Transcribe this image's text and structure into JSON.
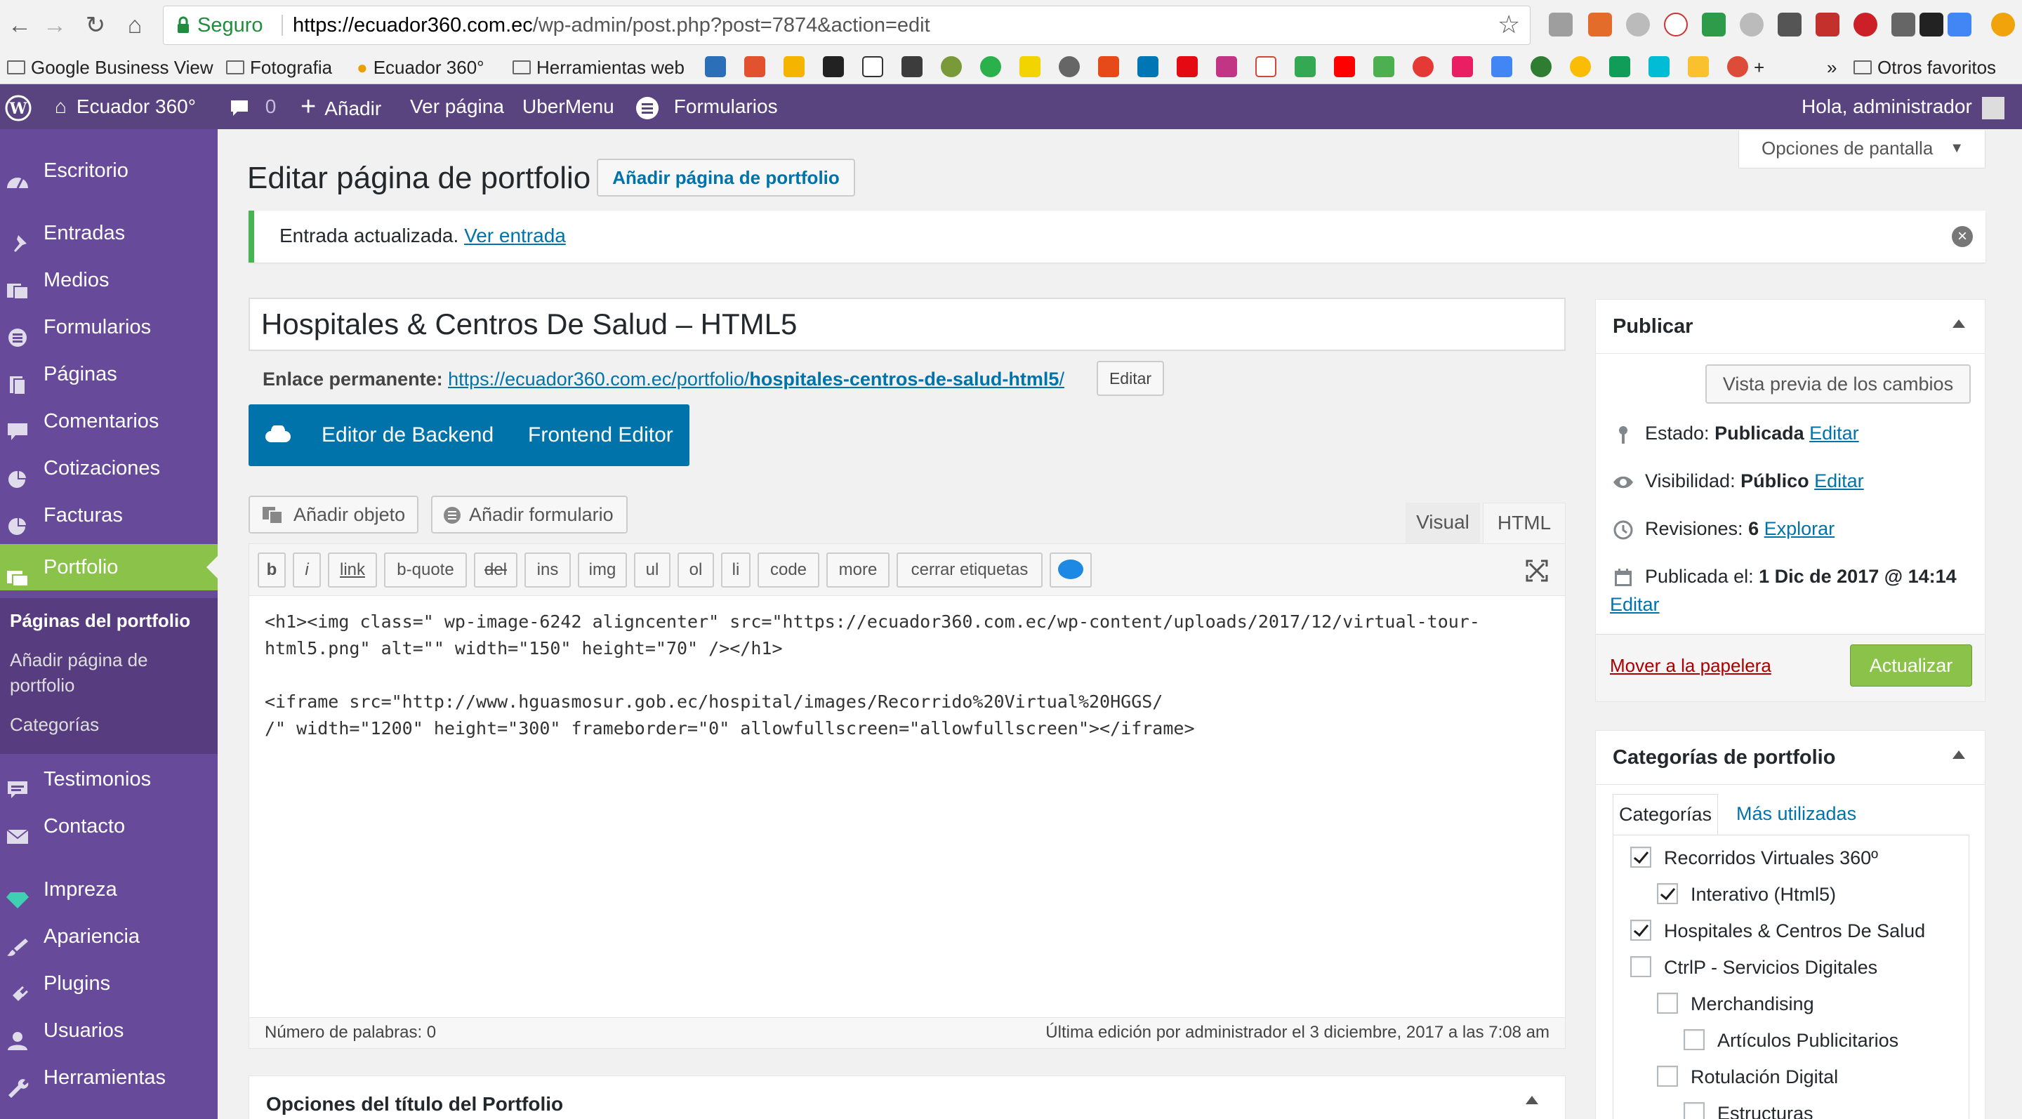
{
  "browser": {
    "security_label": "Seguro",
    "url_host": "https://ecuador360.com.ec",
    "url_path": "/wp-admin/post.php?post=7874&action=edit",
    "bookmarks": [
      "Google Business View",
      "Fotografia",
      "Ecuador 360°",
      "Herramientas web"
    ],
    "more_label": "»",
    "other_bookmarks": "Otros favoritos"
  },
  "adminbar": {
    "site_name": "Ecuador 360°",
    "comments_count": "0",
    "add_label": "Añadir",
    "view_page": "Ver página",
    "ubermenu": "UberMenu",
    "forms": "Formularios",
    "greeting": "Hola, administrador"
  },
  "sidebar": {
    "items": [
      "Escritorio",
      "Entradas",
      "Medios",
      "Formularios",
      "Páginas",
      "Comentarios",
      "Cotizaciones",
      "Facturas",
      "Portfolio",
      "Testimonios",
      "Contacto",
      "Impreza",
      "Apariencia",
      "Plugins",
      "Usuarios",
      "Herramientas"
    ],
    "submenu": [
      "Páginas del portfolio",
      "Añadir página de",
      "portfolio",
      "Categorías"
    ]
  },
  "main": {
    "page_title": "Editar página de portfolio",
    "add_new": "Añadir página de portfolio",
    "screen_options": "Opciones de pantalla",
    "notice_text": "Entrada actualizada.",
    "notice_link": "Ver entrada",
    "post_title": "Hospitales & Centros De Salud – HTML5",
    "permalink_label": "Enlace permanente:",
    "permalink_base": "https://ecuador360.com.ec/portfolio/",
    "permalink_slug": "hospitales-centros-de-salud-html5",
    "permalink_end": "/",
    "permalink_edit": "Editar",
    "vc_backend": "Editor de Backend",
    "vc_frontend": "Frontend Editor",
    "add_media": "Añadir objeto",
    "add_form": "Añadir formulario",
    "tab_visual": "Visual",
    "tab_html": "HTML",
    "quicktags": [
      "b",
      "i",
      "link",
      "b-quote",
      "del",
      "ins",
      "img",
      "ul",
      "ol",
      "li",
      "code",
      "more",
      "cerrar etiquetas"
    ],
    "editor_content": "<h1><img class=\" wp-image-6242 aligncenter\" src=\"https://ecuador360.com.ec/wp-content/uploads/2017/12/virtual-tour-\nhtml5.png\" alt=\"\" width=\"150\" height=\"70\" /></h1>\n\n<iframe src=\"http://www.hguasmosur.gob.ec/hospital/images/Recorrido%20Virtual%20HGGS/\n/\" width=\"1200\" height=\"300\" frameborder=\"0\" allowfullscreen=\"allowfullscreen\"></iframe>",
    "word_count": "Número de palabras: 0",
    "last_edit": "Última edición por administrador el 3 diciembre, 2017 a las 7:08 am",
    "title_options": "Opciones del título del Portfolio"
  },
  "publish": {
    "title": "Publicar",
    "preview": "Vista previa de los cambios",
    "status_label": "Estado:",
    "status_value": "Publicada",
    "visibility_label": "Visibilidad:",
    "visibility_value": "Público",
    "revisions_label": "Revisiones:",
    "revisions_value": "6",
    "revisions_link": "Explorar",
    "published_label": "Publicada el:",
    "published_value": "1 Dic de 2017 @ 14:14",
    "edit": "Editar",
    "trash": "Mover a la papelera",
    "update": "Actualizar"
  },
  "categories": {
    "title": "Categorías de portfolio",
    "tab_all": "Categorías",
    "tab_popular": "Más utilizadas",
    "items": [
      {
        "label": "Recorridos Virtuales 360º",
        "checked": true,
        "level": 0
      },
      {
        "label": "Interativo (Html5)",
        "checked": true,
        "level": 1
      },
      {
        "label": "Hospitales & Centros De Salud",
        "checked": true,
        "level": 0
      },
      {
        "label": "CtrlP - Servicios Digitales",
        "checked": false,
        "level": 0
      },
      {
        "label": "Merchandising",
        "checked": false,
        "level": 1
      },
      {
        "label": "Artículos Publicitarios",
        "checked": false,
        "level": 2
      },
      {
        "label": "Rotulación Digital",
        "checked": false,
        "level": 1
      },
      {
        "label": "Estructuras",
        "checked": false,
        "level": 2
      }
    ]
  },
  "colors": {
    "admin_bar": "#5a4480",
    "sidebar": "#674a99",
    "accent_green": "#8bc34a",
    "link_blue": "#0073aa",
    "vc_blue": "#0073aa"
  }
}
